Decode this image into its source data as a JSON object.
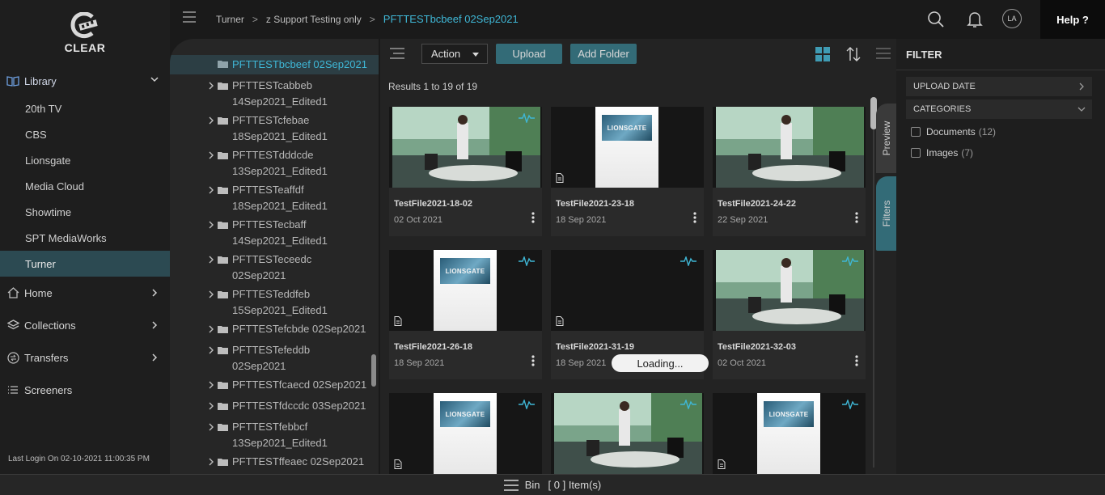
{
  "brand": {
    "name": "CLEAR"
  },
  "nav": {
    "library": "Library",
    "library_items": [
      "20th TV",
      "CBS",
      "Lionsgate",
      "Media Cloud",
      "Showtime",
      "SPT MediaWorks",
      "Turner"
    ],
    "home": "Home",
    "collections": "Collections",
    "transfers": "Transfers",
    "screeners": "Screeners",
    "last_login": "Last Login On 02-10-2021 11:00:35 PM"
  },
  "header": {
    "breadcrumb": [
      "Turner",
      "z Support Testing only",
      "PFTTESTbcbeef 02Sep2021"
    ],
    "avatar_initials": "LA",
    "help_label": "Help ?"
  },
  "tree": {
    "items": [
      {
        "l1": "PFTTESTbcbeef 02Sep2021",
        "l2": ""
      },
      {
        "l1": "PFTTESTcabbeb",
        "l2": "14Sep2021_Edited1"
      },
      {
        "l1": "PFTTESTcfebae",
        "l2": "18Sep2021_Edited1"
      },
      {
        "l1": "PFTTESTdddcde",
        "l2": "13Sep2021_Edited1"
      },
      {
        "l1": "PFTTESTeaffdf",
        "l2": "18Sep2021_Edited1"
      },
      {
        "l1": "PFTTESTecbaff",
        "l2": "14Sep2021_Edited1"
      },
      {
        "l1": "PFTTESTeceedc",
        "l2": "02Sep2021"
      },
      {
        "l1": "PFTTESTeddfeb",
        "l2": "15Sep2021_Edited1"
      },
      {
        "l1": "PFTTESTefcbde 02Sep2021",
        "l2": ""
      },
      {
        "l1": "PFTTESTefeddb",
        "l2": "02Sep2021"
      },
      {
        "l1": "PFTTESTfcaecd 02Sep2021",
        "l2": ""
      },
      {
        "l1": "PFTTESTfdccdc 03Sep2021",
        "l2": ""
      },
      {
        "l1": "PFTTESTfebbcf",
        "l2": "13Sep2021_Edited1"
      },
      {
        "l1": "PFTTESTffeaec 02Sep2021",
        "l2": ""
      }
    ]
  },
  "toolbar": {
    "action_label": "Action",
    "upload_label": "Upload",
    "add_folder_label": "Add Folder"
  },
  "results_text": "Results 1 to 19 of 19",
  "cards": [
    {
      "title": "TestFile2021-18-02",
      "date": "02 Oct 2021"
    },
    {
      "title": "TestFile2021-23-18",
      "date": "18 Sep 2021"
    },
    {
      "title": "TestFile2021-24-22",
      "date": "22 Sep 2021"
    },
    {
      "title": "TestFile2021-26-18",
      "date": "18 Sep 2021"
    },
    {
      "title": "TestFile2021-31-19",
      "date": "18 Sep 2021"
    },
    {
      "title": "TestFile2021-32-03",
      "date": "02 Oct 2021"
    }
  ],
  "lionsgate_logo_text": "LIONSGATE",
  "loading_text": "Loading...",
  "side_tabs": {
    "preview": "Preview",
    "filters": "Filters"
  },
  "filter": {
    "title": "FILTER",
    "upload_date": "UPLOAD DATE",
    "categories": "CATEGORIES",
    "options": [
      {
        "label": "Documents",
        "count": "(12)"
      },
      {
        "label": "Images",
        "count": "(7)"
      }
    ]
  },
  "bin": {
    "label": "Bin",
    "count_text": "[ 0 ] Item(s)"
  },
  "colors": {
    "accent": "#3fb7d6",
    "button": "#336b77",
    "active_nav": "#2c4a52"
  }
}
